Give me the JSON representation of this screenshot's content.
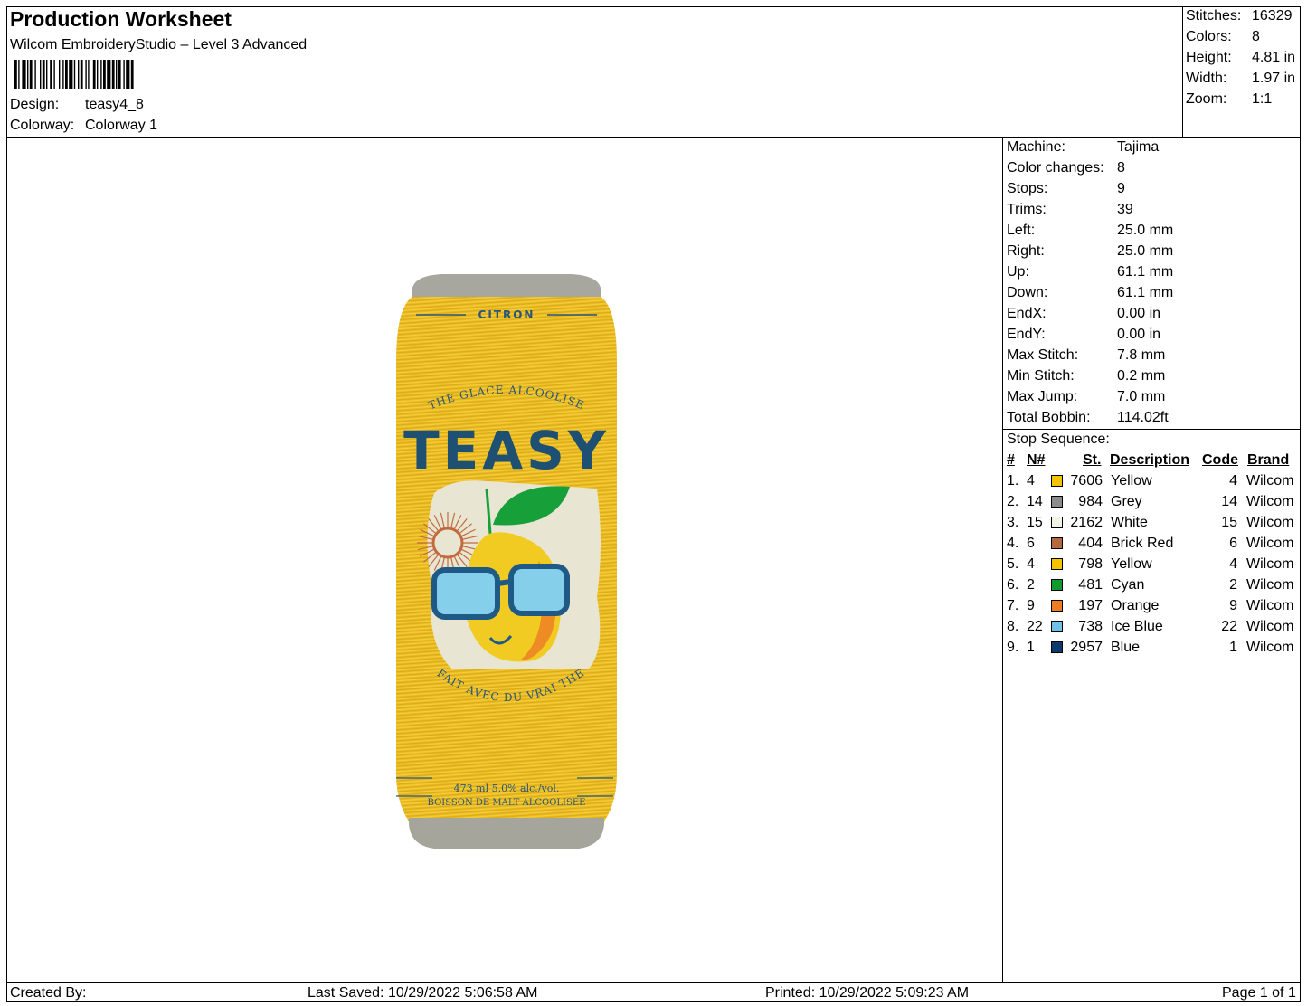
{
  "header": {
    "title": "Production Worksheet",
    "software": "Wilcom EmbroideryStudio – Level 3 Advanced",
    "design_label": "Design:",
    "design_value": "teasy4_8",
    "colorway_label": "Colorway:",
    "colorway_value": "Colorway 1"
  },
  "stats": {
    "stitches_label": "Stitches:",
    "stitches": "16329",
    "colors_label": "Colors:",
    "colors": "8",
    "height_label": "Height:",
    "height": "4.81 in",
    "width_label": "Width:",
    "width": "1.97 in",
    "zoom_label": "Zoom:",
    "zoom": "1:1"
  },
  "machine_info": [
    {
      "label": "Machine:",
      "value": "Tajima"
    },
    {
      "label": "Color changes:",
      "value": "8"
    },
    {
      "label": "Stops:",
      "value": "9"
    },
    {
      "label": "Trims:",
      "value": "39"
    },
    {
      "label": "Left:",
      "value": "25.0 mm"
    },
    {
      "label": "Right:",
      "value": "25.0 mm"
    },
    {
      "label": "Up:",
      "value": "61.1 mm"
    },
    {
      "label": "Down:",
      "value": "61.1 mm"
    },
    {
      "label": "EndX:",
      "value": "0.00 in"
    },
    {
      "label": "EndY:",
      "value": "0.00 in"
    },
    {
      "label": "Max Stitch:",
      "value": "7.8 mm"
    },
    {
      "label": "Min Stitch:",
      "value": "0.2 mm"
    },
    {
      "label": "Max Jump:",
      "value": "7.0 mm"
    },
    {
      "label": "Total Bobbin:",
      "value": "114.02ft"
    }
  ],
  "stop_sequence": {
    "title": "Stop Sequence:",
    "headers": {
      "num": "#",
      "n": "N#",
      "st": "St.",
      "description": "Description",
      "code": "Code",
      "brand": "Brand"
    },
    "rows": [
      {
        "num": "1.",
        "n": "4",
        "color": "#F5C400",
        "st": "7606",
        "description": "Yellow",
        "code": "4",
        "brand": "Wilcom"
      },
      {
        "num": "2.",
        "n": "14",
        "color": "#8C8C8C",
        "st": "984",
        "description": "Grey",
        "code": "14",
        "brand": "Wilcom"
      },
      {
        "num": "3.",
        "n": "15",
        "color": "#F4F4E6",
        "st": "2162",
        "description": "White",
        "code": "15",
        "brand": "Wilcom"
      },
      {
        "num": "4.",
        "n": "6",
        "color": "#B5693E",
        "st": "404",
        "description": "Brick Red",
        "code": "6",
        "brand": "Wilcom"
      },
      {
        "num": "5.",
        "n": "4",
        "color": "#F5C400",
        "st": "798",
        "description": "Yellow",
        "code": "4",
        "brand": "Wilcom"
      },
      {
        "num": "6.",
        "n": "2",
        "color": "#0E9A2C",
        "st": "481",
        "description": "Cyan",
        "code": "2",
        "brand": "Wilcom"
      },
      {
        "num": "7.",
        "n": "9",
        "color": "#EE7C22",
        "st": "197",
        "description": "Orange",
        "code": "9",
        "brand": "Wilcom"
      },
      {
        "num": "8.",
        "n": "22",
        "color": "#6EC2EA",
        "st": "738",
        "description": "Ice Blue",
        "code": "22",
        "brand": "Wilcom"
      },
      {
        "num": "9.",
        "n": "1",
        "color": "#0D3A6E",
        "st": "2957",
        "description": "Blue",
        "code": "1",
        "brand": "Wilcom"
      }
    ]
  },
  "design_text": {
    "flavor": "CITRON",
    "arc_top": "THE GLACE ALCOOLISE",
    "brand": "TEASY",
    "arc_bottom": "FAIT AVEC DU VRAI THE",
    "volume": "473 ml  5,0% alc./vol.",
    "legal": "BOISSON DE MALT ALCOOLISEE"
  },
  "footer": {
    "created_by": "Created By:",
    "last_saved": "Last Saved: 10/29/2022 5:06:58 AM",
    "printed": "Printed: 10/29/2022 5:09:23 AM",
    "page": "Page 1 of 1"
  }
}
